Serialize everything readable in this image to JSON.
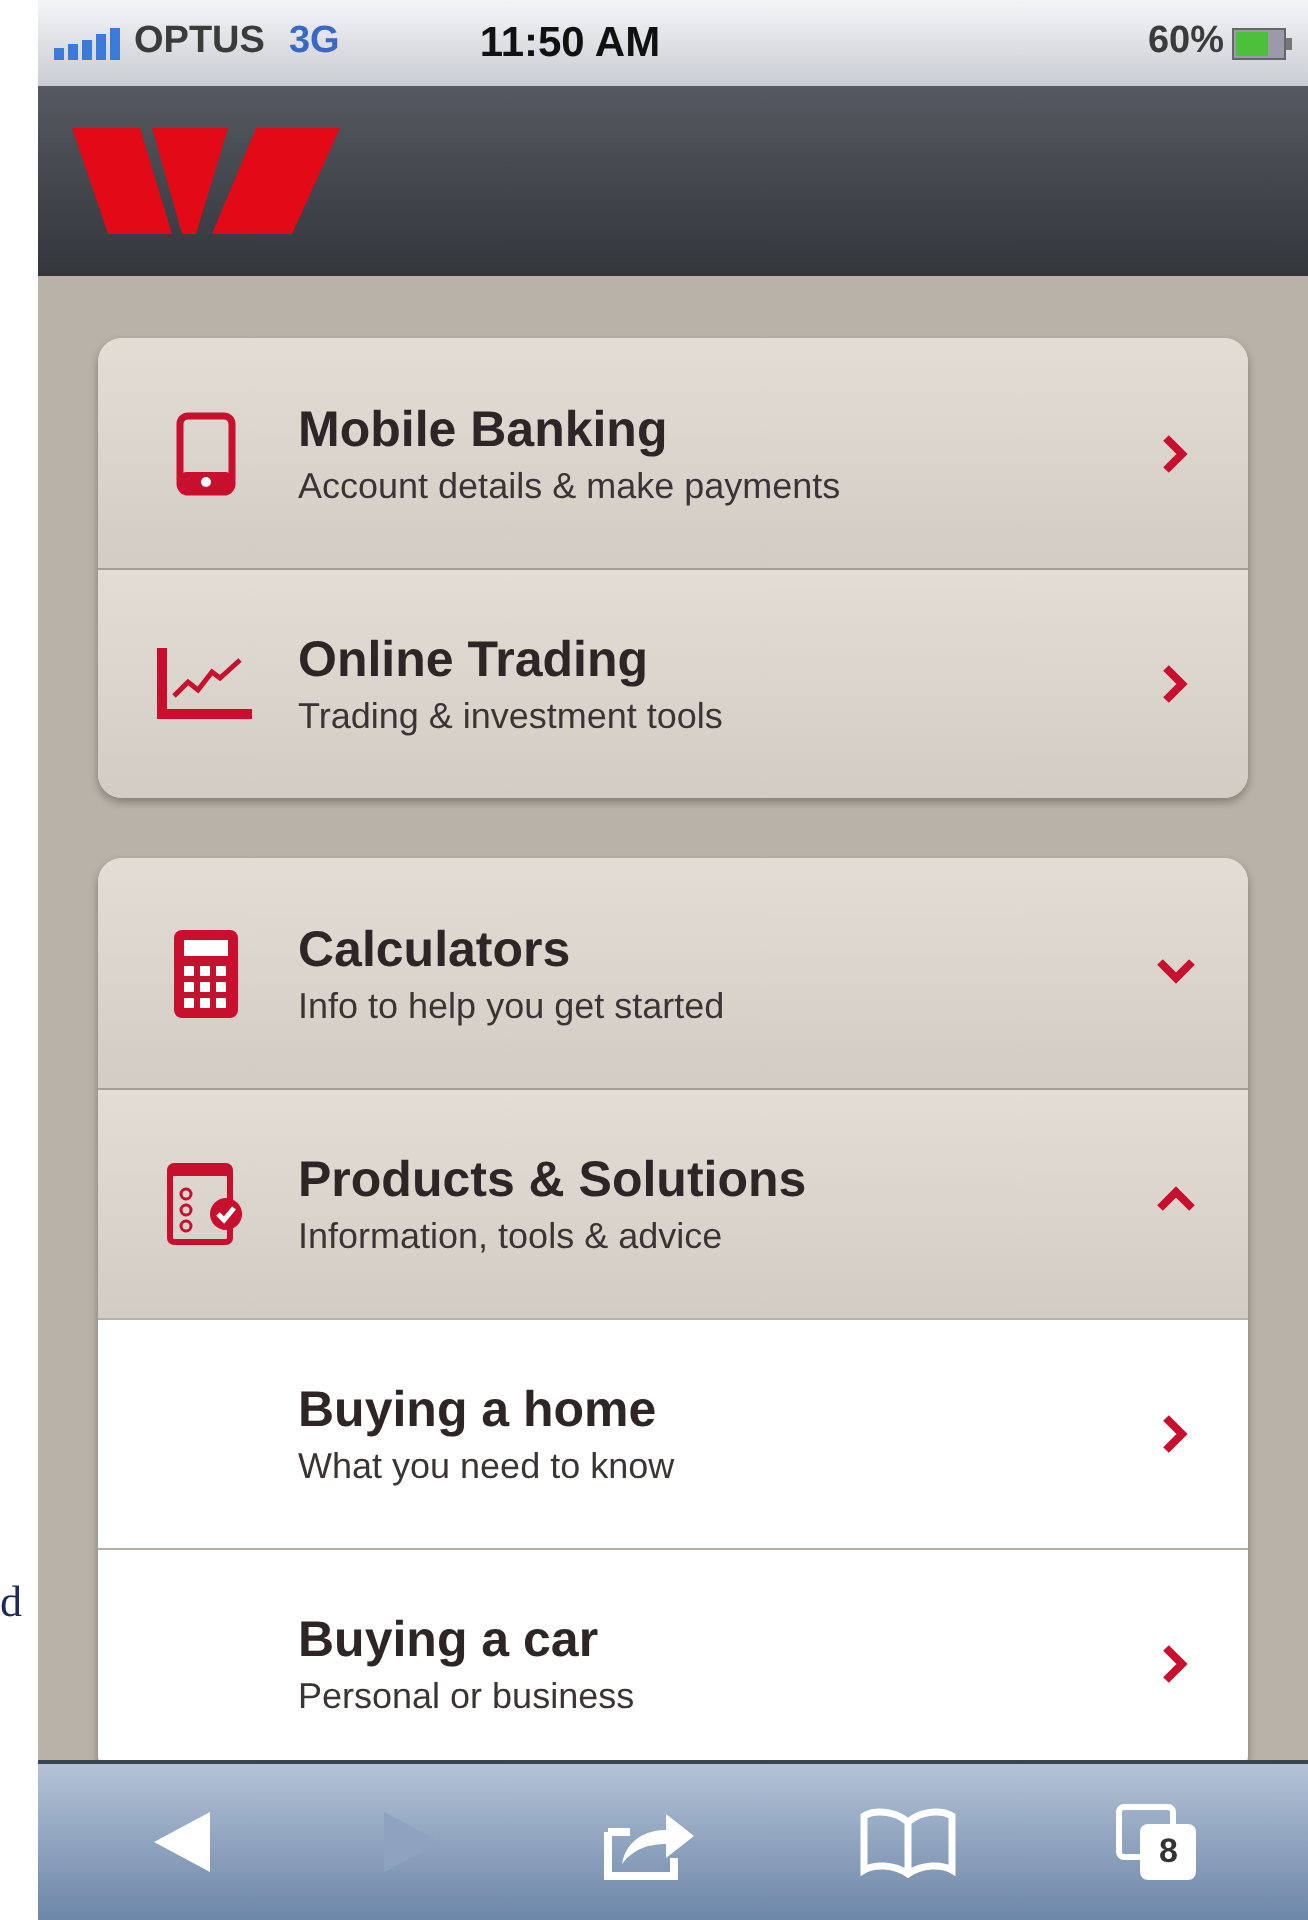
{
  "status_bar": {
    "carrier": "OPTUS",
    "network": "3G",
    "time": "11:50 AM",
    "battery": "60%"
  },
  "side_text": "d",
  "groups": [
    {
      "items": [
        {
          "kind": "link",
          "title": "Mobile Banking",
          "subtitle": "Account details & make payments"
        },
        {
          "kind": "link",
          "title": "Online Trading",
          "subtitle": "Trading & investment tools"
        }
      ]
    },
    {
      "items": [
        {
          "kind": "section",
          "title": "Calculators",
          "subtitle": "Info to help you get started",
          "expanded": false
        },
        {
          "kind": "section",
          "title": "Products & Solutions",
          "subtitle": "Information, tools & advice",
          "expanded": true,
          "children": [
            {
              "title": "Buying a home",
              "subtitle": "What you need to know"
            },
            {
              "title": "Buying a car",
              "subtitle": "Personal or business"
            }
          ]
        }
      ]
    }
  ],
  "toolbar": {
    "back_disabled": false,
    "forward_disabled": true,
    "tab_count": "8"
  }
}
